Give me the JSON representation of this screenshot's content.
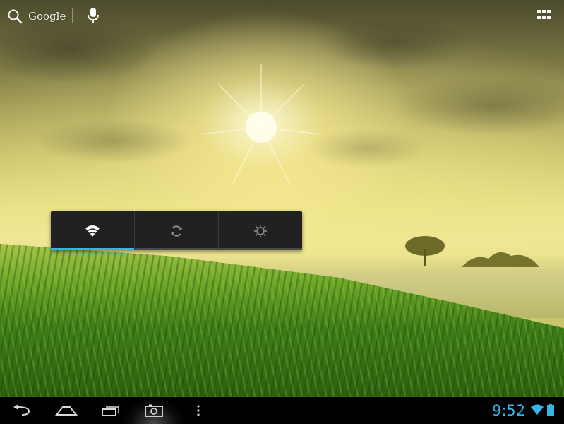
{
  "search_bar": {
    "label": "Google",
    "icons": [
      "search-icon",
      "mic-icon"
    ]
  },
  "apps_button": {
    "icon": "apps-grid-icon"
  },
  "power_control": {
    "buttons": [
      {
        "name": "wifi",
        "icon": "wifi-icon",
        "state": "on"
      },
      {
        "name": "sync",
        "icon": "sync-icon",
        "state": "off"
      },
      {
        "name": "brightness",
        "icon": "brightness-icon",
        "state": "off"
      }
    ],
    "colors": {
      "active": "#33b5e5",
      "inactive": "#4a4a4a",
      "icon_on": "#ffffff",
      "icon_off": "#8a8a8a",
      "background": "#212121"
    }
  },
  "navigation_bar": {
    "buttons": [
      "back-icon",
      "home-icon",
      "recent-apps-icon",
      "screenshot-icon",
      "menu-icon"
    ]
  },
  "status": {
    "time": "9:52",
    "icons": [
      "wifi-signal-icon",
      "battery-icon"
    ],
    "accent": "#33b5e5"
  }
}
